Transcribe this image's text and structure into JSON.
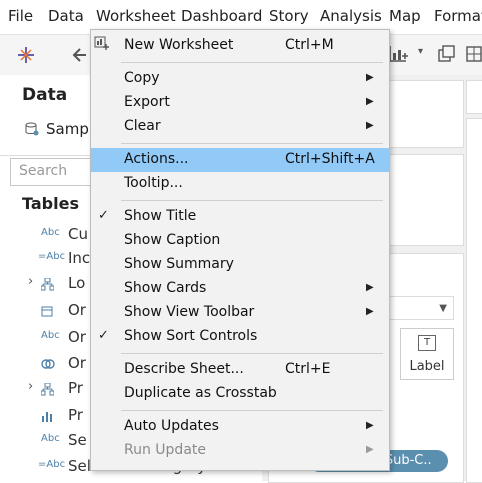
{
  "menubar": {
    "items": [
      "File",
      "Data",
      "Worksheet",
      "Dashboard",
      "Story",
      "Analysis",
      "Map",
      "Format"
    ]
  },
  "data_pane": {
    "title": "Data",
    "datasource": "Samp",
    "search_placeholder": "Search",
    "tables_title": "Tables",
    "fields": [
      {
        "icon": "Abc",
        "label": "Cu",
        "expandable": false
      },
      {
        "icon": "=Abc",
        "label": "Inc",
        "expandable": false
      },
      {
        "icon": "hierarchy-icon",
        "label": "Lo",
        "expandable": true
      },
      {
        "icon": "calendar-icon",
        "label": "Or",
        "expandable": false
      },
      {
        "icon": "Abc",
        "label": "Or",
        "expandable": false
      },
      {
        "icon": "link-icon",
        "label": "Or",
        "expandable": false
      },
      {
        "icon": "hierarchy-icon",
        "label": "Pr",
        "expandable": true
      },
      {
        "icon": "bar-chart-icon",
        "label": "Pr",
        "expandable": false
      },
      {
        "icon": "Abc",
        "label": "Se",
        "expandable": false
      },
      {
        "icon": "=Abc",
        "label": "Selected Category In...",
        "expandable": false
      }
    ]
  },
  "marks": {
    "label_card": "Label",
    "pill": "Selected Sub-C.."
  },
  "worksheet_menu": {
    "items": [
      {
        "label": "New Worksheet",
        "shortcut": "Ctrl+M",
        "submenu": false,
        "checked": false,
        "highlighted": false,
        "disabled": false
      },
      {
        "separator": true
      },
      {
        "label": "Copy",
        "shortcut": "",
        "submenu": true,
        "checked": false,
        "highlighted": false,
        "disabled": false
      },
      {
        "label": "Export",
        "shortcut": "",
        "submenu": true,
        "checked": false,
        "highlighted": false,
        "disabled": false
      },
      {
        "label": "Clear",
        "shortcut": "",
        "submenu": true,
        "checked": false,
        "highlighted": false,
        "disabled": false
      },
      {
        "separator": true
      },
      {
        "label": "Actions...",
        "shortcut": "Ctrl+Shift+A",
        "submenu": false,
        "checked": false,
        "highlighted": true,
        "disabled": false
      },
      {
        "label": "Tooltip...",
        "shortcut": "",
        "submenu": false,
        "checked": false,
        "highlighted": false,
        "disabled": false
      },
      {
        "separator": true
      },
      {
        "label": "Show Title",
        "shortcut": "",
        "submenu": false,
        "checked": true,
        "highlighted": false,
        "disabled": false
      },
      {
        "label": "Show Caption",
        "shortcut": "",
        "submenu": false,
        "checked": false,
        "highlighted": false,
        "disabled": false
      },
      {
        "label": "Show Summary",
        "shortcut": "",
        "submenu": false,
        "checked": false,
        "highlighted": false,
        "disabled": false
      },
      {
        "label": "Show Cards",
        "shortcut": "",
        "submenu": true,
        "checked": false,
        "highlighted": false,
        "disabled": false
      },
      {
        "label": "Show View Toolbar",
        "shortcut": "",
        "submenu": true,
        "checked": false,
        "highlighted": false,
        "disabled": false
      },
      {
        "label": "Show Sort Controls",
        "shortcut": "",
        "submenu": false,
        "checked": true,
        "highlighted": false,
        "disabled": false
      },
      {
        "separator": true
      },
      {
        "label": "Describe Sheet...",
        "shortcut": "Ctrl+E",
        "submenu": false,
        "checked": false,
        "highlighted": false,
        "disabled": false
      },
      {
        "label": "Duplicate as Crosstab",
        "shortcut": "",
        "submenu": false,
        "checked": false,
        "highlighted": false,
        "disabled": false
      },
      {
        "separator": true
      },
      {
        "label": "Auto Updates",
        "shortcut": "",
        "submenu": true,
        "checked": false,
        "highlighted": false,
        "disabled": false
      },
      {
        "label": "Run Update",
        "shortcut": "",
        "submenu": true,
        "checked": false,
        "highlighted": false,
        "disabled": true
      }
    ]
  },
  "colors": {
    "highlight": "#91c9f7",
    "menu_bg": "#f2f2f2",
    "pill": "#5b8fb0",
    "field_icon": "#4d7fa7"
  }
}
